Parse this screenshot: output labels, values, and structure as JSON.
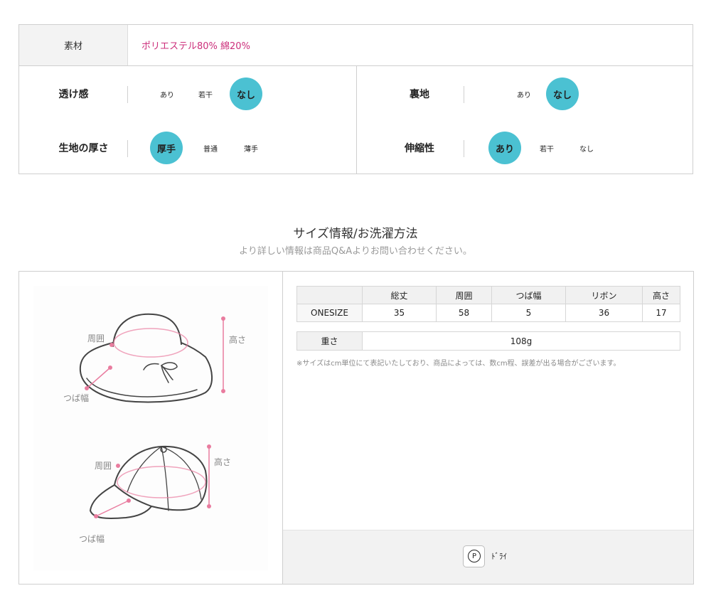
{
  "material": {
    "label": "素材",
    "value": "ポリエステル80% 綿20%"
  },
  "attributes": [
    {
      "label": "透け感",
      "options": [
        "あり",
        "若干",
        "なし"
      ],
      "selected": "なし"
    },
    {
      "label": "裏地",
      "options": [
        "あり",
        "なし"
      ],
      "selected": "なし"
    },
    {
      "label": "生地の厚さ",
      "options": [
        "厚手",
        "普通",
        "薄手"
      ],
      "selected": "厚手"
    },
    {
      "label": "伸縮性",
      "options": [
        "あり",
        "若干",
        "なし"
      ],
      "selected": "あり"
    }
  ],
  "size_section": {
    "title": "サイズ情報/お洗濯方法",
    "subtitle": "より詳しい情報は商品Q&Aよりお問い合わせください。"
  },
  "illustration": {
    "hat1": {
      "circumference": "周囲",
      "height": "高さ",
      "brim": "つば幅"
    },
    "hat2": {
      "circumference": "周囲",
      "height": "高さ",
      "brim": "つば幅"
    }
  },
  "size_table": {
    "headers": [
      "",
      "総丈",
      "周囲",
      "つば幅",
      "リボン",
      "高さ"
    ],
    "rows": [
      [
        "ONESIZE",
        "35",
        "58",
        "5",
        "36",
        "17"
      ]
    ]
  },
  "weight": {
    "label": "重さ",
    "value": "108g"
  },
  "note": "※サイズはcm単位にて表記いたしており、商品によっては、数cm程、誤差が出る場合がございます。",
  "care": {
    "icon": "dry-clean-p-icon",
    "symbol": "P",
    "label": "ﾄﾞﾗｲ"
  },
  "colors": {
    "accent": "#4bc1d2",
    "material_text": "#cc2f7b",
    "guide_pink": "#e97c9f"
  }
}
